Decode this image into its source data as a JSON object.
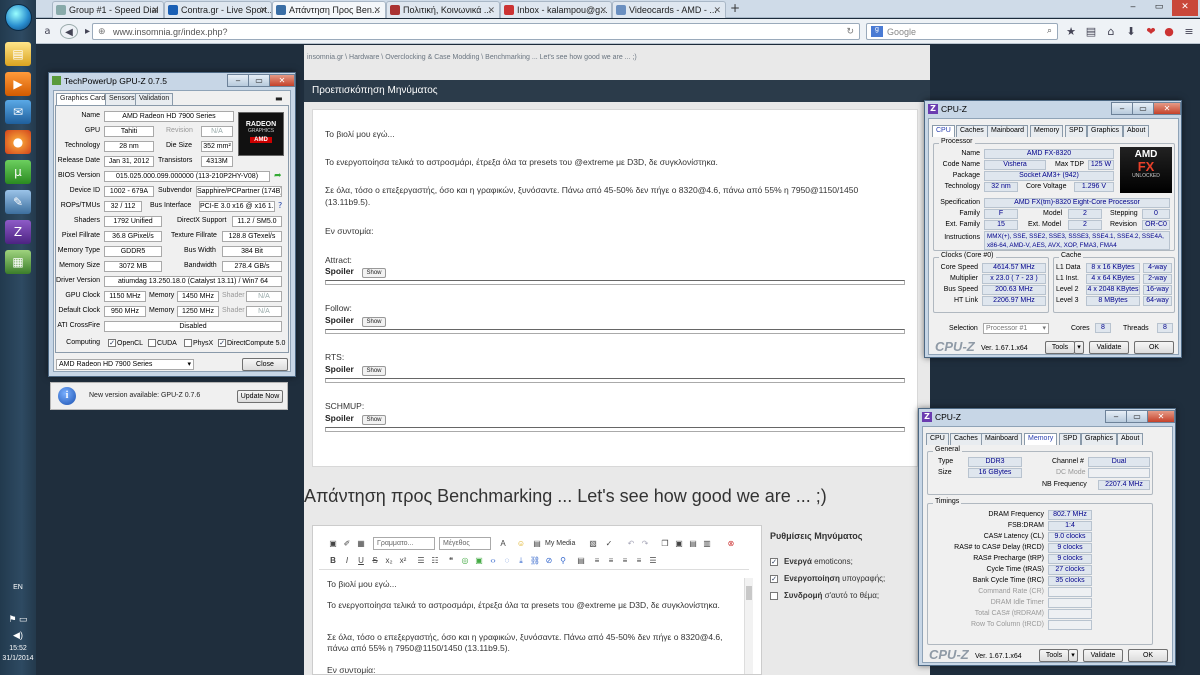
{
  "taskbar": {
    "lang": "EN",
    "time": "15:52",
    "date": "31/1/2014"
  },
  "browser": {
    "tabs": [
      {
        "label": "Group #1 - Speed Dial",
        "color": "#8aa"
      },
      {
        "label": "Contra.gr - Live Sport...",
        "color": "#1a5fb4"
      },
      {
        "label": "Απάντηση Προς Ben...",
        "color": "#3a6ea5"
      },
      {
        "label": "Πολιτική, Κοινωνικά ...",
        "color": "#a33"
      },
      {
        "label": "Inbox - kalampou@g...",
        "color": "#c33"
      },
      {
        "label": "Videocards - AMD - ...",
        "color": "#6a8fc0"
      }
    ],
    "url": "www.insomnia.gr/index.php?",
    "search_placeholder": "Google"
  },
  "forum": {
    "breadcrumb": "insomnia.gr  \\  Hardware  \\  Overclocking & Case Modding  \\  Benchmarking ... Let's see how good we are ... ;)",
    "preview_title": "Προεπισκόπηση Μηνύματος",
    "p1": "Το βιολί μου εγώ...",
    "p2": "Το ενεργοποίησα τελικά το αστροσμάρι, έτρεξα όλα τα presets του @extreme με D3D, δε συγκλονίστηκα.",
    "p3": "Σε όλα, τόσο ο επεξεργαστής, όσο και η γραφικών, ξυνόσαντε. Πάνω από 45-50% δεν πήγε ο 8320@4.6, πάνω από 55% η 7950@1150/1450 (13.11b9.5).",
    "p4": "Εν συντομία:",
    "spoiler_label": "Spoiler",
    "show_label": "Show",
    "sections": [
      "Attract:",
      "Follow:",
      "RTS:",
      "SCHMUP:"
    ],
    "reply_title": "Απάντηση προς Benchmarking ... Let's see how good we are ... ;)",
    "font_combo": "Γραμματο...",
    "size_combo": "Μέγεθος",
    "my_media": "My Media",
    "ed_p1": "Το βιολί μου εγώ...",
    "ed_p2": "Το ενεργοποίησα τελικά το αστροσμάρι, έτρεξα όλα τα presets του @extreme με D3D, δε συγκλονίστηκα.",
    "ed_p3": "Σε όλα, τόσο ο επεξεργαστής, όσο και η γραφικών, ξυνόσαντε. Πάνω από 45-50% δεν πήγε ο 8320@4.6, πάνω από 55% η 7950@1150/1450 (13.11b9.5).",
    "ed_p4": "Εν συντομία:",
    "settings_title": "Ρυθμίσεις Μηνύματος",
    "settings": [
      {
        "bold": "Ενεργά",
        "rest": " emoticons;",
        "checked": "✓"
      },
      {
        "bold": "Ενεργοποίηση",
        "rest": " υπογραφής;",
        "checked": "✓"
      },
      {
        "bold": "Συνδρομή",
        "rest": " σ'αυτό το θέμα;",
        "checked": ""
      }
    ]
  },
  "gpuz": {
    "title": "TechPowerUp GPU-Z 0.7.5",
    "tabs": [
      "Graphics Card",
      "Sensors",
      "Validation"
    ],
    "name": "AMD Radeon HD 7900 Series",
    "gpu": "Tahiti",
    "revision": "N/A",
    "technology": "28 nm",
    "die_size": "352 mm²",
    "release_date": "Jan 31, 2012",
    "transistors": "4313M",
    "bios": "015.025.000.099.000000 (113-210P2HY-V08)",
    "device_id": "1002 - 679A",
    "subvendor": "Sapphire/PCPartner (174B)",
    "rops": "32 / 112",
    "bus_interface": "PCI-E 3.0 x16 @ x16 1.1",
    "shaders": "1792 Unified",
    "directx": "11.2 / SM5.0",
    "pixel_fillrate": "36.8 GPixel/s",
    "texture_fillrate": "128.8 GTexel/s",
    "memory_type": "GDDR5",
    "bus_width": "384 Bit",
    "memory_size": "3072 MB",
    "bandwidth": "278.4 GB/s",
    "driver": "atiumdag 13.250.18.0 (Catalyst 13.11) / Win7 64",
    "gpu_clock": "1150 MHz",
    "memory_clock": "1450 MHz",
    "shader_clock": "N/A",
    "default_clock": "950 MHz",
    "default_memory": "1250 MHz",
    "default_shader": "N/A",
    "crossfire": "Disabled",
    "computing": [
      "OpenCL",
      "CUDA",
      "PhysX",
      "DirectCompute 5.0"
    ],
    "computing_checked": [
      "✓",
      "",
      "",
      "✓"
    ],
    "labels": {
      "name": "Name",
      "gpu": "GPU",
      "revision": "Revision",
      "technology": "Technology",
      "die_size": "Die Size",
      "release_date": "Release Date",
      "transistors": "Transistors",
      "bios": "BIOS Version",
      "device_id": "Device ID",
      "subvendor": "Subvendor",
      "rops": "ROPs/TMUs",
      "bus_interface": "Bus Interface",
      "shaders": "Shaders",
      "directx": "DirectX Support",
      "pixel_fillrate": "Pixel Fillrate",
      "texture_fillrate": "Texture Fillrate",
      "memory_type": "Memory Type",
      "bus_width": "Bus Width",
      "memory_size": "Memory Size",
      "bandwidth": "Bandwidth",
      "driver": "Driver Version",
      "gpu_clock": "GPU Clock",
      "memory": "Memory",
      "shader": "Shader",
      "default_clock": "Default Clock",
      "crossfire": "ATI CrossFire",
      "computing": "Computing"
    },
    "select_value": "AMD Radeon HD 7900 Series",
    "close_label": "Close",
    "logo_top": "RADEON",
    "logo_sub": "GRAPHICS",
    "logo_amd": "AMD",
    "update_text": "New version available: GPU-Z 0.7.6",
    "update_button": "Update Now",
    "info_glyph": "i"
  },
  "cpuz1": {
    "title": "CPU-Z",
    "tabs": [
      "CPU",
      "Caches",
      "Mainboard",
      "Memory",
      "SPD",
      "Graphics",
      "About"
    ],
    "processor_group": "Processor",
    "name": "AMD FX-8320",
    "code_name": "Vishera",
    "max_tdp": "125 W",
    "package": "Socket AM3+ (942)",
    "technology": "32 nm",
    "core_voltage": "1.296 V",
    "specification": "AMD FX(tm)-8320 Eight-Core Processor",
    "family": "F",
    "model": "2",
    "stepping": "0",
    "ext_family": "15",
    "ext_model": "2",
    "revision": "OR-C0",
    "instructions": "MMX(+), SSE, SSE2, SSE3, SSSE3, SSE4.1, SSE4.2, SSE4A, x86-64, AMD-V, AES, AVX, XOP, FMA3, FMA4",
    "clocks_group": "Clocks (Core #0)",
    "core_speed": "4614.57 MHz",
    "multiplier": "x 23.0 ( 7 - 23 )",
    "bus_speed": "200.63 MHz",
    "ht_link": "2206.97 MHz",
    "cache_group": "Cache",
    "l1d": "8 x 16 KBytes",
    "l1d_way": "4-way",
    "l1i": "4 x 64 KBytes",
    "l1i_way": "2-way",
    "l2": "4 x 2048 KBytes",
    "l2_way": "16-way",
    "l3": "8 MBytes",
    "l3_way": "64-way",
    "selection": "Processor #1",
    "cores": "8",
    "threads": "8",
    "version": "Ver. 1.67.1.x64",
    "tools": "Tools",
    "validate": "Validate",
    "ok": "OK",
    "brand": "CPU-Z",
    "labels": {
      "name": "Name",
      "code_name": "Code Name",
      "max_tdp": "Max TDP",
      "package": "Package",
      "technology": "Technology",
      "core_voltage": "Core Voltage",
      "specification": "Specification",
      "family": "Family",
      "model": "Model",
      "stepping": "Stepping",
      "ext_family": "Ext. Family",
      "ext_model": "Ext. Model",
      "revision": "Revision",
      "instructions": "Instructions",
      "core_speed": "Core Speed",
      "multiplier": "Multiplier",
      "bus_speed": "Bus Speed",
      "ht_link": "HT Link",
      "l1d": "L1 Data",
      "l1i": "L1 Inst.",
      "l2": "Level 2",
      "l3": "Level 3",
      "selection": "Selection",
      "cores": "Cores",
      "threads": "Threads"
    },
    "logo_amd": "AMD",
    "logo_fx": "FX",
    "logo_sub": "UNLOCKED"
  },
  "cpuz2": {
    "title": "CPU-Z",
    "tabs": [
      "CPU",
      "Caches",
      "Mainboard",
      "Memory",
      "SPD",
      "Graphics",
      "About"
    ],
    "general_group": "General",
    "type": "DDR3",
    "channel": "Dual",
    "size": "16 GBytes",
    "dc_mode": "",
    "nb_frequency": "2207.4 MHz",
    "timings_group": "Timings",
    "timings": [
      {
        "label": "DRAM Frequency",
        "value": "802.7 MHz",
        "dim": false
      },
      {
        "label": "FSB:DRAM",
        "value": "1:4",
        "dim": false
      },
      {
        "label": "CAS# Latency (CL)",
        "value": "9.0 clocks",
        "dim": false
      },
      {
        "label": "RAS# to CAS# Delay (tRCD)",
        "value": "9 clocks",
        "dim": false
      },
      {
        "label": "RAS# Precharge (tRP)",
        "value": "9 clocks",
        "dim": false
      },
      {
        "label": "Cycle Time (tRAS)",
        "value": "27 clocks",
        "dim": false
      },
      {
        "label": "Bank Cycle Time (tRC)",
        "value": "35 clocks",
        "dim": false
      },
      {
        "label": "Command Rate (CR)",
        "value": "",
        "dim": true
      },
      {
        "label": "DRAM Idle Timer",
        "value": "",
        "dim": true
      },
      {
        "label": "Total CAS# (tRDRAM)",
        "value": "",
        "dim": true
      },
      {
        "label": "Row To Column (tRCD)",
        "value": "",
        "dim": true
      }
    ],
    "labels": {
      "type": "Type",
      "channel": "Channel #",
      "size": "Size",
      "dc_mode": "DC Mode",
      "nb_frequency": "NB Frequency"
    },
    "version": "Ver. 1.67.1.x64",
    "tools": "Tools",
    "validate": "Validate",
    "ok": "OK",
    "brand": "CPU-Z"
  }
}
